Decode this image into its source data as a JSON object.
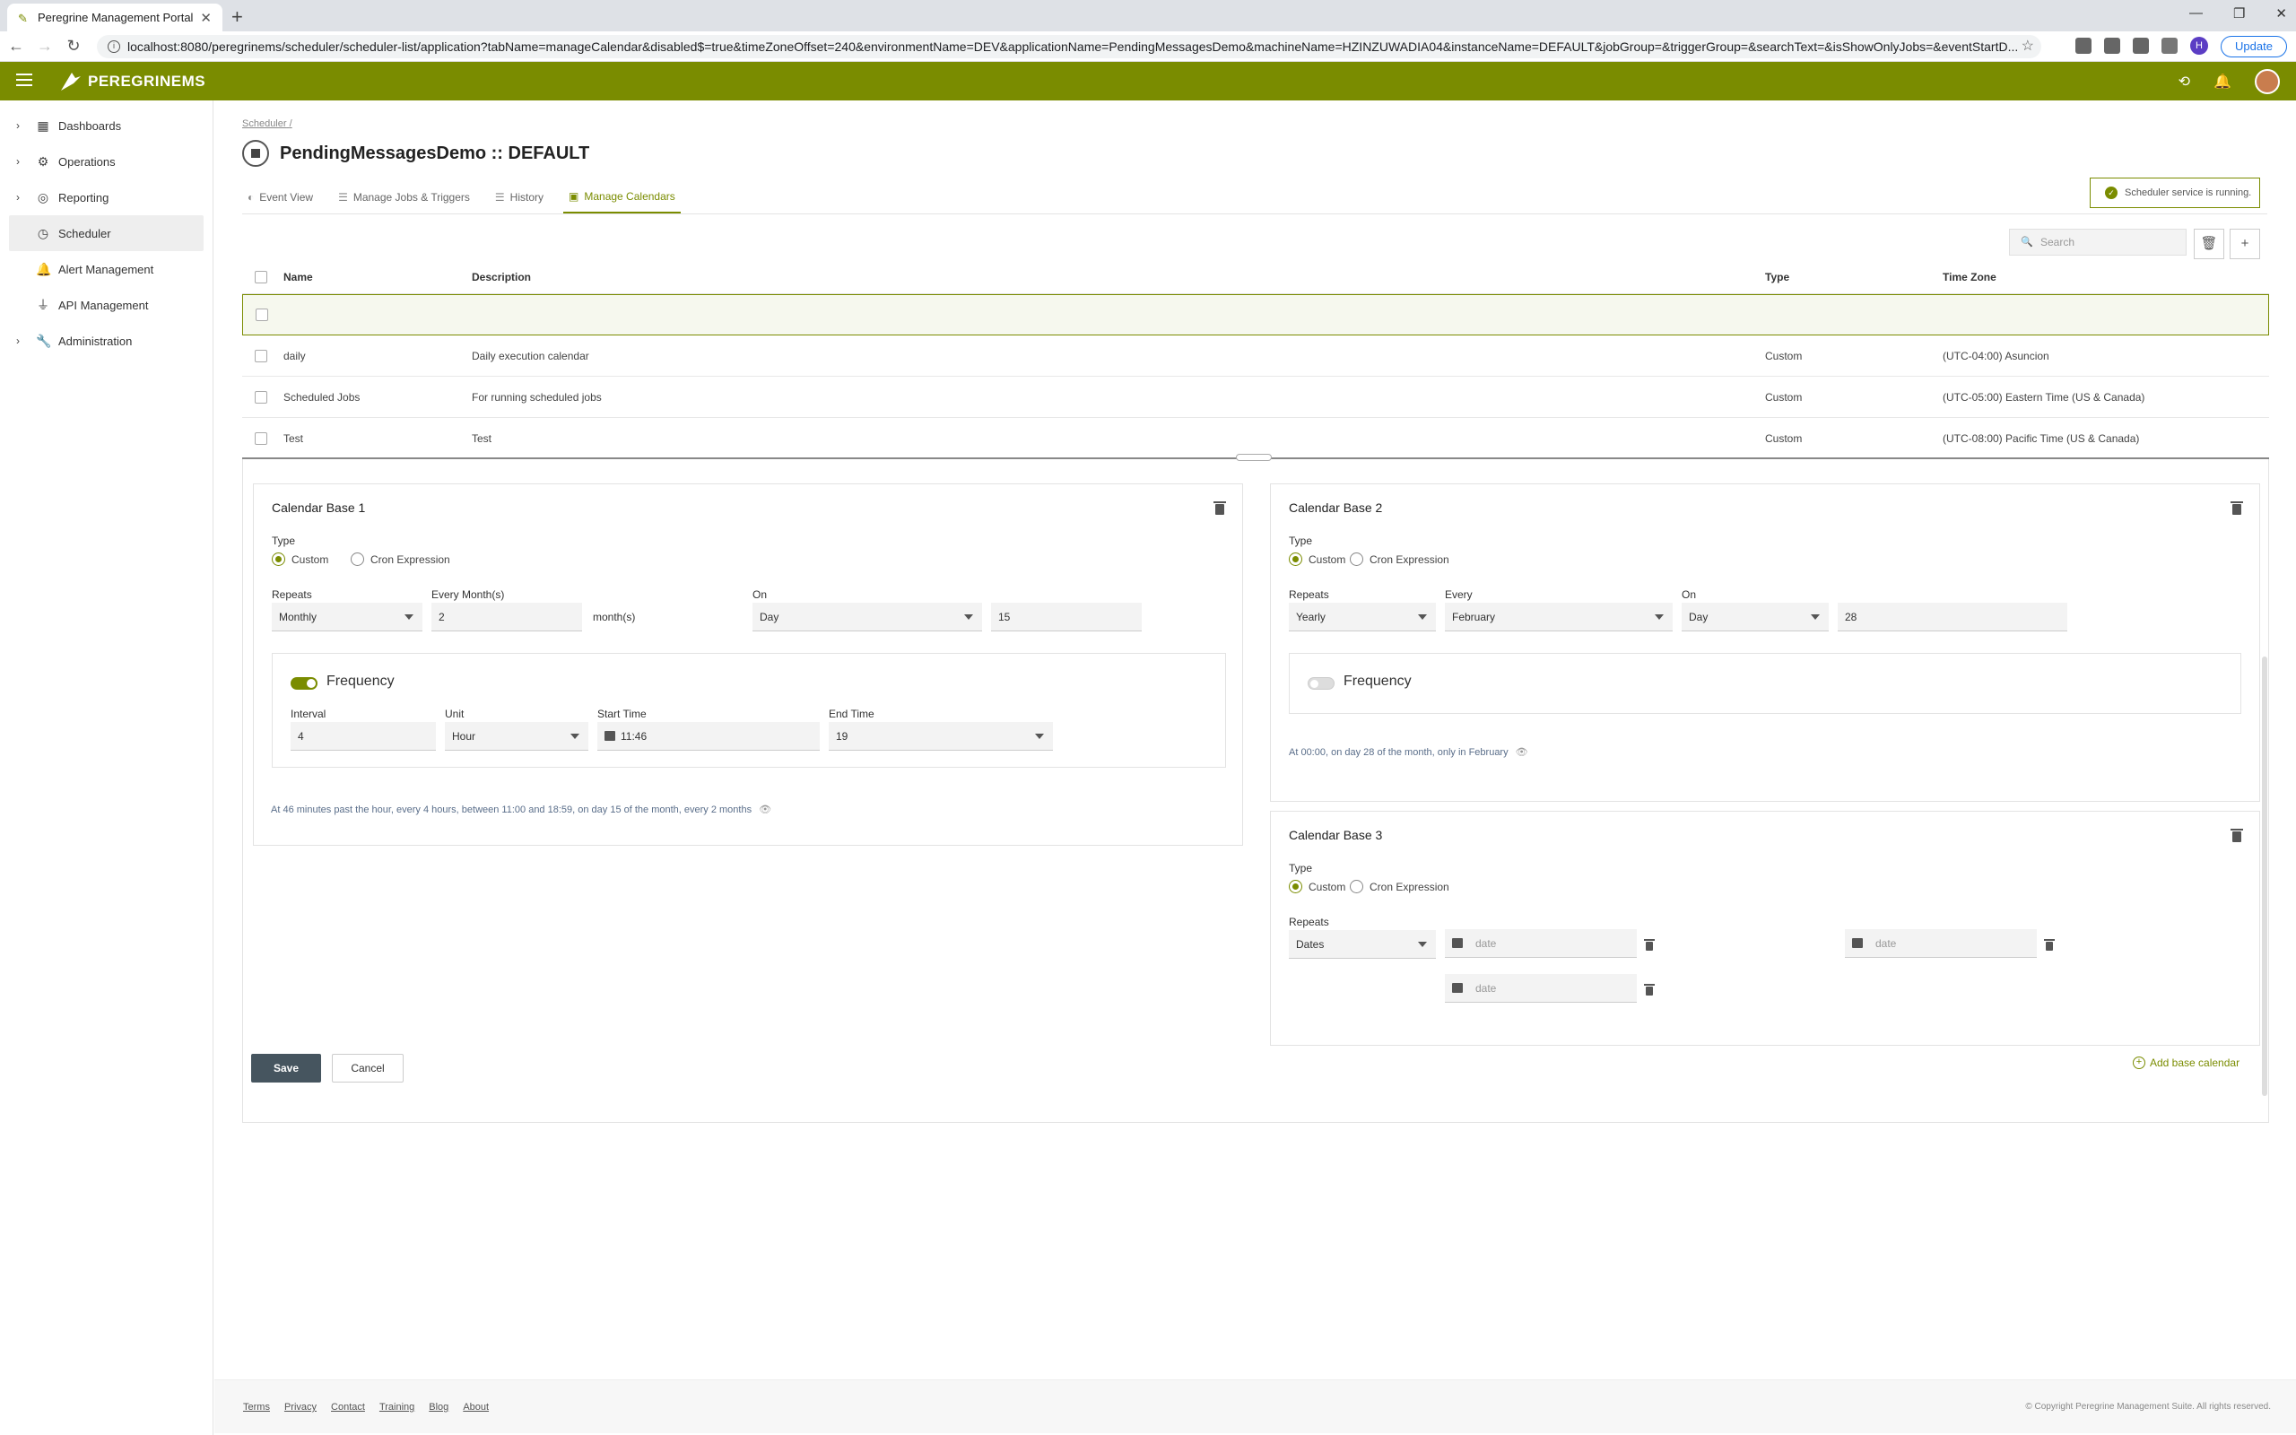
{
  "browser": {
    "tab_title": "Peregrine Management Portal",
    "url": "localhost:8080/peregrinems/scheduler/scheduler-list/application?tabName=manageCalendar&disabled$=true&timeZoneOffset=240&environmentName=DEV&applicationName=PendingMessagesDemo&machineName=HZINZUWADIA04&instanceName=DEFAULT&jobGroup=&triggerGroup=&searchText=&isShowOnlyJobs=&eventStartD...",
    "profile_initial": "H",
    "update_label": "Update"
  },
  "app": {
    "brand": "PEREGRINEMS",
    "accent": "#7a8c00"
  },
  "sidebar": {
    "items": [
      {
        "label": "Dashboards",
        "icon": "dashboard-icon"
      },
      {
        "label": "Operations",
        "icon": "gear-icon"
      },
      {
        "label": "Reporting",
        "icon": "target-icon"
      },
      {
        "label": "Scheduler",
        "icon": "clock-icon"
      },
      {
        "label": "Alert Management",
        "icon": "bell-icon"
      },
      {
        "label": "API Management",
        "icon": "plug-icon"
      },
      {
        "label": "Administration",
        "icon": "wrench-icon"
      }
    ]
  },
  "page": {
    "breadcrumb": "Scheduler",
    "breadcrumb_sep": "/",
    "title": "PendingMessagesDemo :: DEFAULT",
    "status": "Scheduler service is running.",
    "search_placeholder": "Search",
    "tabs": [
      "Event View",
      "Manage Jobs & Triggers",
      "History",
      "Manage Calendars"
    ]
  },
  "table": {
    "headers": [
      "Name",
      "Description",
      "Type",
      "Time Zone"
    ],
    "rows": [
      {
        "name": "",
        "description": "",
        "type": "",
        "tz": ""
      },
      {
        "name": "daily",
        "description": "Daily execution calendar",
        "type": "Custom",
        "tz": "(UTC-04:00) Asuncion"
      },
      {
        "name": "Scheduled Jobs",
        "description": "For running scheduled jobs",
        "type": "Custom",
        "tz": "(UTC-05:00) Eastern Time (US & Canada)"
      },
      {
        "name": "Test",
        "description": "Test",
        "type": "Custom",
        "tz": "(UTC-08:00) Pacific Time (US & Canada)"
      }
    ]
  },
  "calendar1": {
    "title": "Calendar Base 1",
    "type_label": "Type",
    "opt_custom": "Custom",
    "opt_cron": "Cron Expression",
    "repeats_label": "Repeats",
    "repeats": "Monthly",
    "every_label": "Every Month(s)",
    "every": "2",
    "every_unit": "month(s)",
    "on_label": "On",
    "on": "Day",
    "day": "15",
    "freq_label": "Frequency",
    "interval_label": "Interval",
    "interval": "4",
    "unit_label": "Unit",
    "unit": "Hour",
    "start_label": "Start Time",
    "start": "11:46",
    "end_label": "End Time",
    "end": "19",
    "summary": "At 46 minutes past the hour, every 4 hours, between 11:00 and 18:59, on day 15 of the month, every 2 months"
  },
  "calendar2": {
    "title": "Calendar Base 2",
    "type_label": "Type",
    "opt_custom": "Custom",
    "opt_cron": "Cron Expression",
    "repeats_label": "Repeats",
    "repeats": "Yearly",
    "every_label": "Every",
    "every": "February",
    "on_label": "On",
    "on": "Day",
    "day": "28",
    "freq_label": "Frequency",
    "summary": "At 00:00, on day 28 of the month, only in February"
  },
  "calendar3": {
    "title": "Calendar Base 3",
    "type_label": "Type",
    "opt_custom": "Custom",
    "opt_cron": "Cron Expression",
    "repeats_label": "Repeats",
    "repeats": "Dates",
    "date_placeholder": "date"
  },
  "actions": {
    "save": "Save",
    "cancel": "Cancel",
    "add_base": "Add base calendar"
  },
  "footer": {
    "links": [
      "Terms",
      "Privacy",
      "Contact",
      "Training",
      "Blog",
      "About"
    ],
    "copyright": "© Copyright Peregrine Management Suite. All rights reserved."
  }
}
